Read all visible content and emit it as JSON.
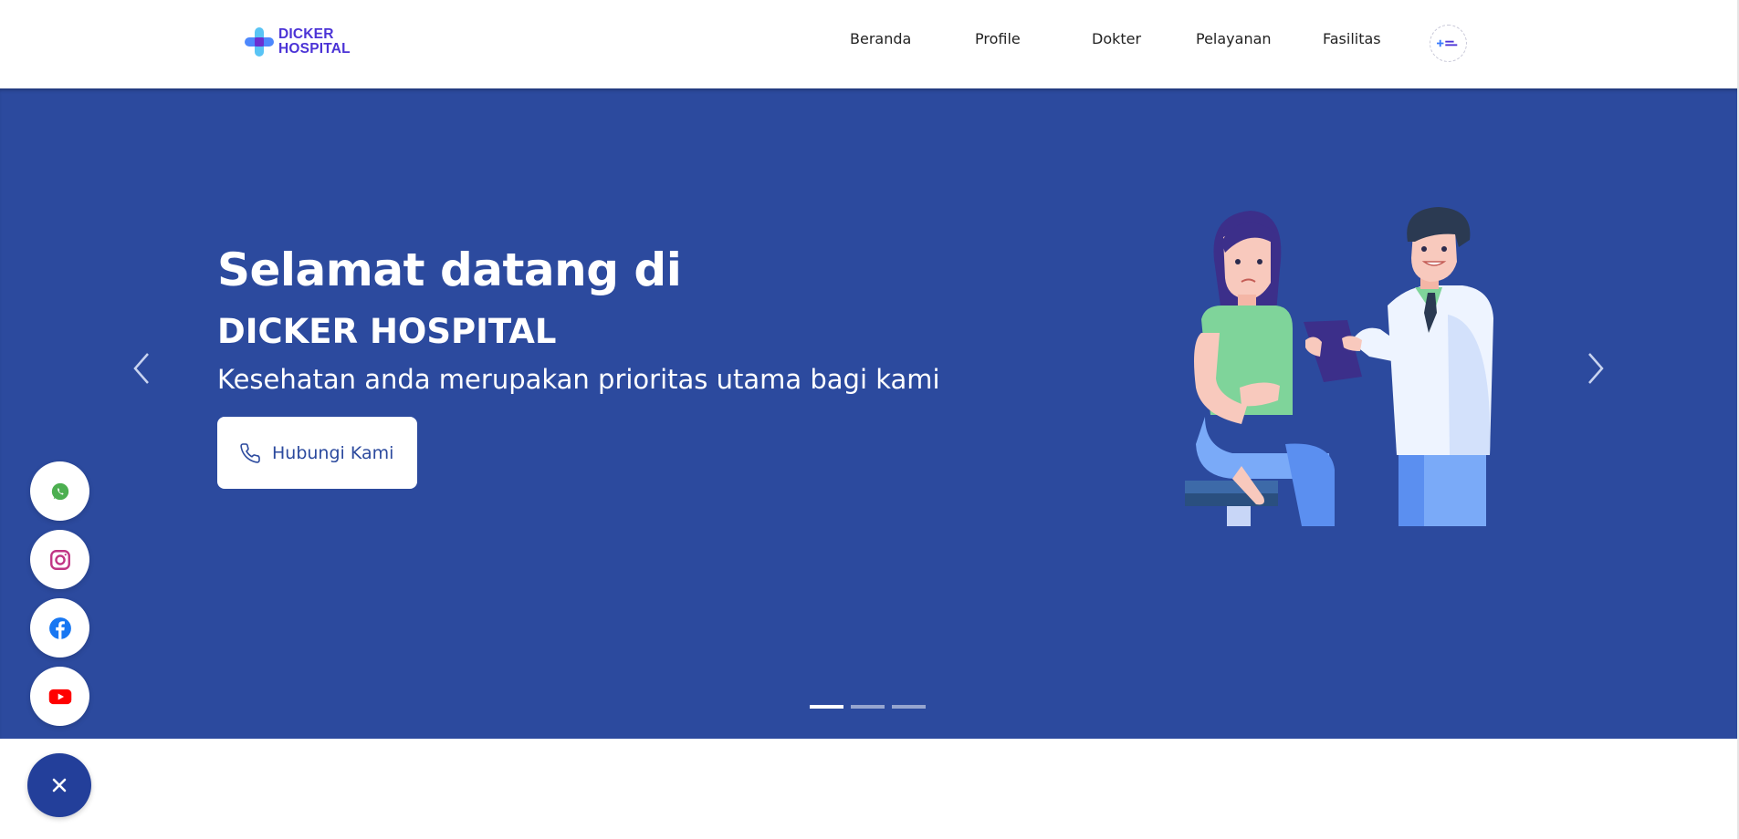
{
  "brand": {
    "line1": "DICKER",
    "line2": "HOSPITAL",
    "accent": "#4b33d6",
    "cross_colors": [
      "#3a7bfd",
      "#59c4f5",
      "#6b2fd0"
    ]
  },
  "nav": {
    "items": [
      {
        "label": "Beranda"
      },
      {
        "label": "Profile"
      },
      {
        "label": "Dokter"
      },
      {
        "label": "Pelayanan"
      },
      {
        "label": "Fasilitas"
      }
    ],
    "badge_icon": "hospital-badge-icon"
  },
  "hero": {
    "background": "#2c4a9e",
    "title": "Selamat datang di",
    "subtitle": "DICKER HOSPITAL",
    "tagline": "Kesehatan anda merupakan prioritas utama bagi kami",
    "cta_label": "Hubungi Kami",
    "cta_icon": "phone-icon",
    "prev_icon": "chevron-left-icon",
    "next_icon": "chevron-right-icon",
    "slides": {
      "count": 3,
      "active": 1
    }
  },
  "social": [
    {
      "icon": "whatsapp-icon",
      "color": "#4caf50"
    },
    {
      "icon": "instagram-icon",
      "color": "#c13584"
    },
    {
      "icon": "facebook-icon",
      "color": "#1877f2"
    },
    {
      "icon": "youtube-icon",
      "color": "#ff0000"
    }
  ],
  "fab": {
    "icon": "close-icon",
    "color": "#233f9a"
  }
}
